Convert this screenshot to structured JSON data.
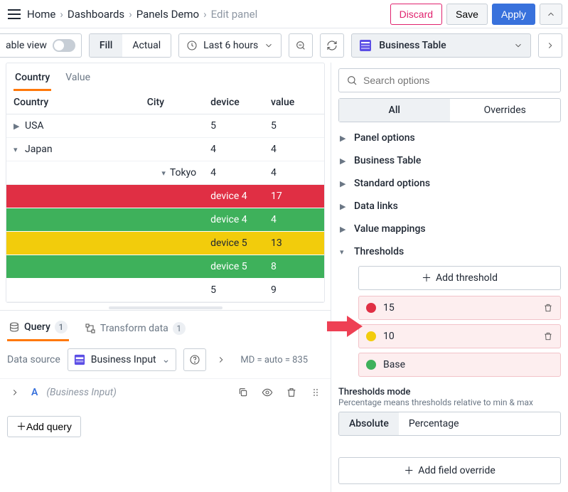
{
  "breadcrumb": {
    "items": [
      "Home",
      "Dashboards",
      "Panels Demo",
      "Edit panel"
    ],
    "muted_index": 3
  },
  "header_buttons": {
    "discard": "Discard",
    "save": "Save",
    "apply": "Apply"
  },
  "toolbar": {
    "tableview_label": "able view",
    "fill": "Fill",
    "actual": "Actual",
    "timerange": "Last 6 hours"
  },
  "visualization": {
    "name": "Business Table"
  },
  "panel_tabs": {
    "country": "Country",
    "value": "Value"
  },
  "table": {
    "headers": [
      "Country",
      "City",
      "device",
      "value"
    ],
    "rows": [
      {
        "kind": "exp-right",
        "cells": [
          "USA",
          "",
          "",
          ""
        ]
      },
      {
        "kind": "exp-down",
        "cells": [
          "Japan",
          "",
          "4",
          "4"
        ]
      },
      {
        "kind": "sub",
        "cells": [
          "",
          "Tokyo",
          "4",
          "4"
        ],
        "city_caret": "down"
      },
      {
        "kind": "red",
        "cells": [
          "",
          "",
          "device 4",
          "17"
        ]
      },
      {
        "kind": "green",
        "cells": [
          "",
          "",
          "device 4",
          "4"
        ]
      },
      {
        "kind": "yellow",
        "cells": [
          "",
          "",
          "device 5",
          "13"
        ]
      },
      {
        "kind": "green",
        "cells": [
          "",
          "",
          "device 5",
          "8"
        ]
      },
      {
        "kind": "plain",
        "cells": [
          "",
          "",
          "5",
          "9"
        ]
      }
    ],
    "usa_summary": {
      "device": "5",
      "value": "5"
    }
  },
  "bottom_tabs": {
    "query": "Query",
    "query_badge": "1",
    "transform": "Transform data",
    "transform_badge": "1"
  },
  "datasource": {
    "label": "Data source",
    "selected": "Business Input",
    "mdtext": "MD = auto = 835"
  },
  "queryrow": {
    "letter": "A",
    "dsname": "(Business Input)"
  },
  "add_query": "Add query",
  "right": {
    "search_placeholder": "Search options",
    "all": "All",
    "overrides": "Overrides",
    "sections": [
      "Panel options",
      "Business Table",
      "Standard options",
      "Data links",
      "Value mappings",
      "Thresholds"
    ],
    "add_threshold": "Add threshold",
    "thresholds": [
      {
        "color": "red",
        "label": "15"
      },
      {
        "color": "yellow",
        "label": "10"
      },
      {
        "color": "green",
        "label": "Base"
      }
    ],
    "mode_label": "Thresholds mode",
    "mode_desc": "Percentage means thresholds relative to min & max",
    "absolute": "Absolute",
    "percentage": "Percentage",
    "add_field_override": "Add field override"
  }
}
